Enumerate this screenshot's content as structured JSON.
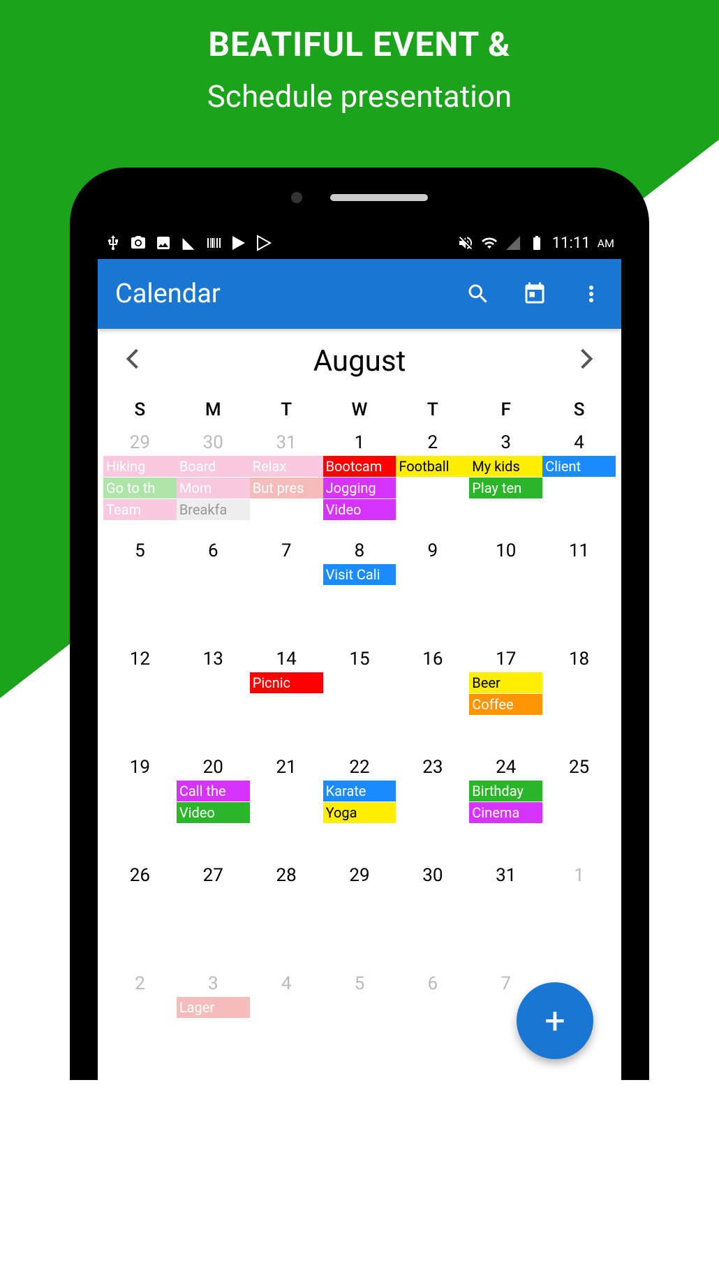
{
  "promo": {
    "title": "BEATIFUL EVENT &",
    "subtitle": "Schedule presentation"
  },
  "status": {
    "time": "11:11",
    "ampm": "AM"
  },
  "appbar": {
    "title": "Calendar"
  },
  "month": {
    "name": "August"
  },
  "weekdays": [
    "S",
    "M",
    "T",
    "W",
    "T",
    "F",
    "S"
  ],
  "weeks": [
    [
      {
        "num": "29",
        "faded": true,
        "events": [
          {
            "text": "Hiking",
            "bg": "#f8c9df",
            "fg": "#fff"
          },
          {
            "text": "Go to th",
            "bg": "#aee5a8",
            "fg": "#fff"
          },
          {
            "text": "Team",
            "bg": "#f8c9df",
            "fg": "#fff"
          }
        ]
      },
      {
        "num": "30",
        "faded": true,
        "events": [
          {
            "text": "Board",
            "bg": "#f8c9df",
            "fg": "#fff"
          },
          {
            "text": "Mom",
            "bg": "#f8c9df",
            "fg": "#fff"
          },
          {
            "text": "Breakfa",
            "bg": "#eee",
            "fg": "#999"
          }
        ]
      },
      {
        "num": "31",
        "faded": true,
        "events": [
          {
            "text": "Relax",
            "bg": "#f8c9df",
            "fg": "#fff"
          },
          {
            "text": "But pres",
            "bg": "#f5bcbc",
            "fg": "#fff"
          }
        ]
      },
      {
        "num": "1",
        "events": [
          {
            "text": "Bootcam",
            "bg": "#ff0000",
            "fg": "#fff"
          },
          {
            "text": "Jogging",
            "bg": "#d633ff",
            "fg": "#fff"
          },
          {
            "text": "Video",
            "bg": "#d633ff",
            "fg": "#fff"
          }
        ]
      },
      {
        "num": "2",
        "events": [
          {
            "text": "Football",
            "bg": "#ffee00",
            "fg": "#000"
          }
        ]
      },
      {
        "num": "3",
        "events": [
          {
            "text": "My kids",
            "bg": "#ffee00",
            "fg": "#000"
          },
          {
            "text": "Play ten",
            "bg": "#2bb52b",
            "fg": "#fff"
          }
        ]
      },
      {
        "num": "4",
        "events": [
          {
            "text": "Client",
            "bg": "#1a8cff",
            "fg": "#fff"
          }
        ]
      }
    ],
    [
      {
        "num": "5"
      },
      {
        "num": "6"
      },
      {
        "num": "7"
      },
      {
        "num": "8",
        "events": [
          {
            "text": "Visit Cali",
            "bg": "#1a8cff",
            "fg": "#fff"
          }
        ]
      },
      {
        "num": "9"
      },
      {
        "num": "10"
      },
      {
        "num": "11"
      }
    ],
    [
      {
        "num": "12"
      },
      {
        "num": "13"
      },
      {
        "num": "14",
        "events": [
          {
            "text": "Picnic",
            "bg": "#ff0000",
            "fg": "#fff"
          }
        ]
      },
      {
        "num": "15"
      },
      {
        "num": "16"
      },
      {
        "num": "17",
        "events": [
          {
            "text": "Beer",
            "bg": "#ffee00",
            "fg": "#000"
          },
          {
            "text": "Coffee",
            "bg": "#ff9500",
            "fg": "#fff"
          }
        ]
      },
      {
        "num": "18"
      }
    ],
    [
      {
        "num": "19"
      },
      {
        "num": "20",
        "events": [
          {
            "text": "Call the",
            "bg": "#d633ff",
            "fg": "#fff"
          },
          {
            "text": "Video",
            "bg": "#2bb52b",
            "fg": "#fff"
          }
        ]
      },
      {
        "num": "21"
      },
      {
        "num": "22",
        "events": [
          {
            "text": "Karate",
            "bg": "#1a8cff",
            "fg": "#fff"
          },
          {
            "text": "Yoga",
            "bg": "#ffee00",
            "fg": "#000"
          }
        ]
      },
      {
        "num": "23"
      },
      {
        "num": "24",
        "events": [
          {
            "text": "Birthday",
            "bg": "#2bb52b",
            "fg": "#fff"
          },
          {
            "text": "Cinema",
            "bg": "#d633ff",
            "fg": "#fff"
          }
        ]
      },
      {
        "num": "25"
      }
    ],
    [
      {
        "num": "26"
      },
      {
        "num": "27"
      },
      {
        "num": "28"
      },
      {
        "num": "29"
      },
      {
        "num": "30"
      },
      {
        "num": "31"
      },
      {
        "num": "1",
        "faded": true
      }
    ],
    [
      {
        "num": "2",
        "faded": true
      },
      {
        "num": "3",
        "faded": true,
        "events": [
          {
            "text": "Lager",
            "bg": "#f5bcbc",
            "fg": "#fff"
          }
        ]
      },
      {
        "num": "4",
        "faded": true
      },
      {
        "num": "5",
        "faded": true
      },
      {
        "num": "6",
        "faded": true
      },
      {
        "num": "7",
        "faded": true
      },
      {
        "num": "",
        "faded": true
      }
    ]
  ],
  "fab": {
    "label": "+"
  }
}
